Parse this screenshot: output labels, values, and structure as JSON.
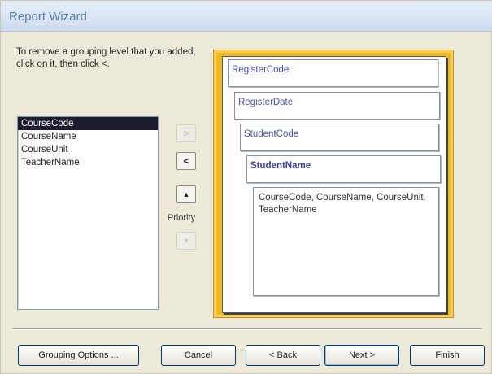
{
  "window": {
    "title": "Report Wizard"
  },
  "instruction": "To remove a grouping level that you added, click on it, then click <.",
  "fields": [
    {
      "label": "CourseCode",
      "selected": true
    },
    {
      "label": "CourseName",
      "selected": false
    },
    {
      "label": "CourseUnit",
      "selected": false
    },
    {
      "label": "TeacherName",
      "selected": false
    }
  ],
  "controls": {
    "add_label": ">",
    "remove_label": "<",
    "priority_up_label": "▲",
    "priority_label": "Priority",
    "priority_down_label": "▼"
  },
  "preview": {
    "group_levels": [
      "RegisterCode",
      "RegisterDate",
      "StudentCode",
      "StudentName"
    ],
    "detail_fields": "CourseCode, CourseName, CourseUnit, TeacherName"
  },
  "buttons": {
    "grouping_options": "Grouping Options ...",
    "cancel": "Cancel",
    "back": "< Back",
    "next": "Next >",
    "finish": "Finish"
  },
  "colors": {
    "selection": "#1c1c2e",
    "preview_border": "#f2b81c",
    "group_text": "#4a4fb0"
  }
}
